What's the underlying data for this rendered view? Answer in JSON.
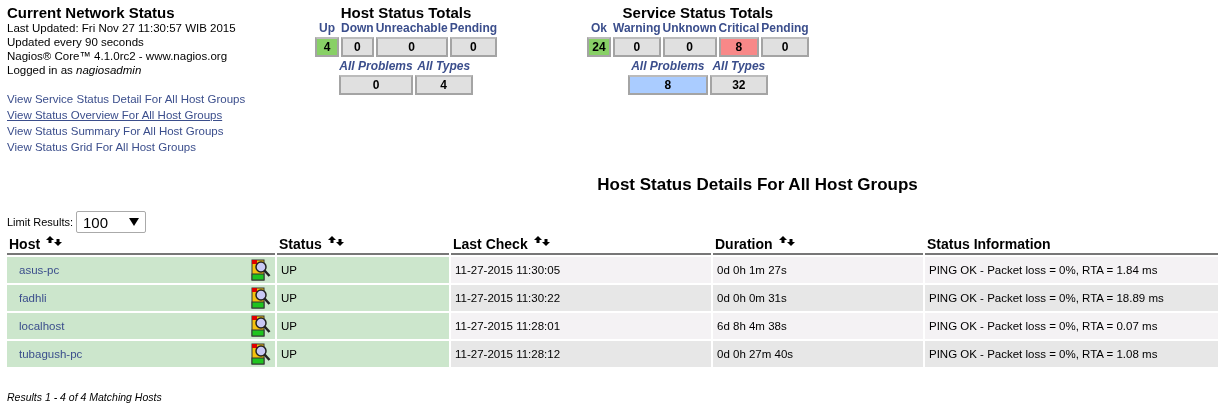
{
  "info": {
    "title": "Current Network Status",
    "lines": [
      "Last Updated: Fri Nov 27 11:30:57 WIB 2015",
      "Updated every 90 seconds",
      "Nagios® Core™ 4.1.0rc2 - www.nagios.org",
      "Logged in as *nagiosadmin*"
    ],
    "links": [
      {
        "label": "View Service Status Detail For All Host Groups",
        "hover": false
      },
      {
        "label": "View Status Overview For All Host Groups",
        "hover": true
      },
      {
        "label": "View Status Summary For All Host Groups",
        "hover": false
      },
      {
        "label": "View Status Grid For All Host Groups",
        "hover": false
      }
    ]
  },
  "host_totals": {
    "title": "Host Status Totals",
    "cells": [
      {
        "label": "Up",
        "value": "4",
        "color": "#88d066"
      },
      {
        "label": "Down",
        "value": "0",
        "color": "#e0e0e0"
      },
      {
        "label": "Unreachable",
        "value": "0",
        "color": "#e0e0e0"
      },
      {
        "label": "Pending",
        "value": "0",
        "color": "#e0e0e0"
      }
    ],
    "summary": [
      {
        "label": "All Problems",
        "value": "0",
        "color": "#e0e0e0"
      },
      {
        "label": "All Types",
        "value": "4",
        "color": "#e0e0e0"
      }
    ]
  },
  "service_totals": {
    "title": "Service Status Totals",
    "cells": [
      {
        "label": "Ok",
        "value": "24",
        "color": "#88d066"
      },
      {
        "label": "Warning",
        "value": "0",
        "color": "#e0e0e0"
      },
      {
        "label": "Unknown",
        "value": "0",
        "color": "#e0e0e0"
      },
      {
        "label": "Critical",
        "value": "8",
        "color": "#f88888"
      },
      {
        "label": "Pending",
        "value": "0",
        "color": "#e0e0e0"
      }
    ],
    "summary": [
      {
        "label": "All Problems",
        "value": "8",
        "color": "#aaccff"
      },
      {
        "label": "All Types",
        "value": "32",
        "color": "#e0e0e0"
      }
    ]
  },
  "heading": "Host Status Details For All Host Groups",
  "limit": {
    "label": "Limit Results:",
    "value": "100"
  },
  "table": {
    "columns": [
      {
        "label": "Host",
        "sortable": true
      },
      {
        "label": "Status",
        "sortable": true
      },
      {
        "label": "Last Check",
        "sortable": true
      },
      {
        "label": "Duration",
        "sortable": true
      },
      {
        "label": "Status Information",
        "sortable": false
      }
    ],
    "rows": [
      {
        "host": "asus-pc",
        "status": "UP",
        "color": "#cce6cc",
        "last_check": "11-27-2015 11:30:05",
        "duration": "0d 0h 1m 27s",
        "info": "PING OK - Packet loss = 0%, RTA = 1.84 ms"
      },
      {
        "host": "fadhli",
        "status": "UP",
        "color": "#cce6cc",
        "last_check": "11-27-2015 11:30:22",
        "duration": "0d 0h 0m 31s",
        "info": "PING OK - Packet loss = 0%, RTA = 18.89 ms"
      },
      {
        "host": "localhost",
        "status": "UP",
        "color": "#cce6cc",
        "last_check": "11-27-2015 11:28:01",
        "duration": "6d 8h 4m 38s",
        "info": "PING OK - Packet loss = 0%, RTA = 0.07 ms"
      },
      {
        "host": "tubagush-pc",
        "status": "UP",
        "color": "#cce6cc",
        "last_check": "11-27-2015 11:28:12",
        "duration": "0d 0h 27m 40s",
        "info": "PING OK - Packet loss = 0%, RTA = 1.08 ms"
      }
    ]
  },
  "footer": "Results 1 - 4 of 4 Matching Hosts"
}
